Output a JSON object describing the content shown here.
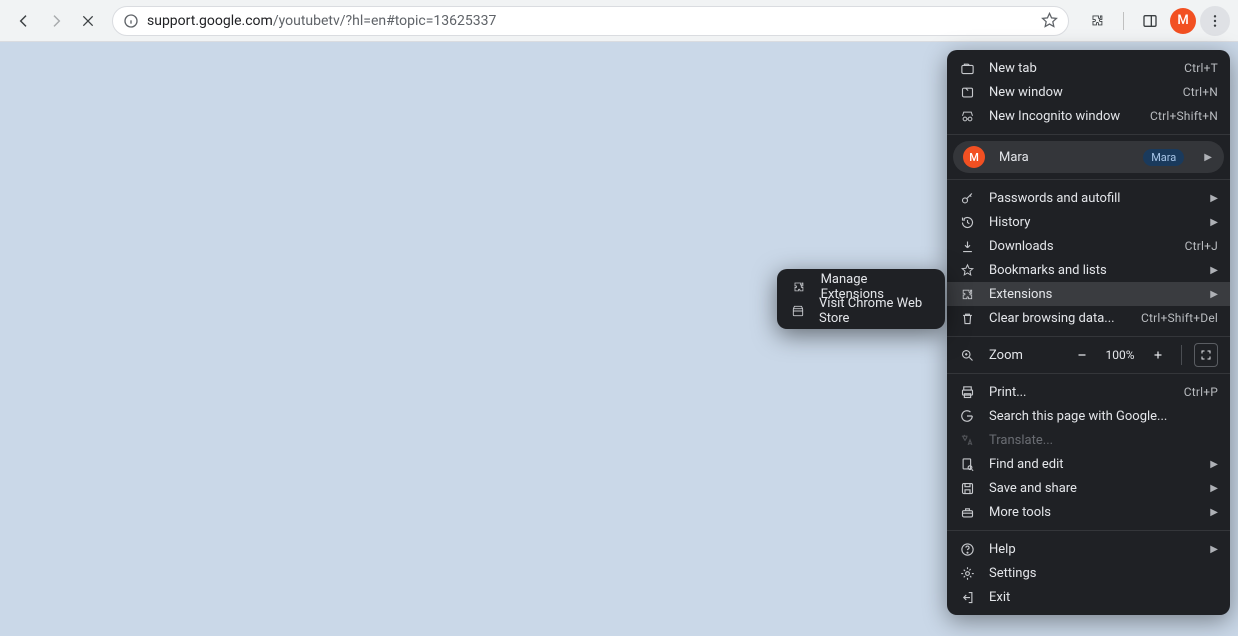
{
  "toolbar": {
    "url_host": "support.google.com",
    "url_path": "/youtubetv/?hl=en#topic=13625337",
    "avatar_initial": "M"
  },
  "menu": {
    "new_tab": {
      "label": "New tab",
      "shortcut": "Ctrl+T"
    },
    "new_window": {
      "label": "New window",
      "shortcut": "Ctrl+N"
    },
    "new_incognito": {
      "label": "New Incognito window",
      "shortcut": "Ctrl+Shift+N"
    },
    "profile": {
      "name": "Mara",
      "badge": "Mara",
      "initial": "M"
    },
    "passwords": {
      "label": "Passwords and autofill"
    },
    "history": {
      "label": "History"
    },
    "downloads": {
      "label": "Downloads",
      "shortcut": "Ctrl+J"
    },
    "bookmarks": {
      "label": "Bookmarks and lists"
    },
    "extensions": {
      "label": "Extensions"
    },
    "clear_data": {
      "label": "Clear browsing data...",
      "shortcut": "Ctrl+Shift+Del"
    },
    "zoom": {
      "label": "Zoom",
      "value": "100%"
    },
    "print": {
      "label": "Print...",
      "shortcut": "Ctrl+P"
    },
    "search_page": {
      "label": "Search this page with Google..."
    },
    "translate": {
      "label": "Translate..."
    },
    "find_edit": {
      "label": "Find and edit"
    },
    "save_share": {
      "label": "Save and share"
    },
    "more_tools": {
      "label": "More tools"
    },
    "help": {
      "label": "Help"
    },
    "settings": {
      "label": "Settings"
    },
    "exit": {
      "label": "Exit"
    }
  },
  "submenu": {
    "manage": {
      "label": "Manage Extensions"
    },
    "webstore": {
      "label": "Visit Chrome Web Store"
    }
  }
}
